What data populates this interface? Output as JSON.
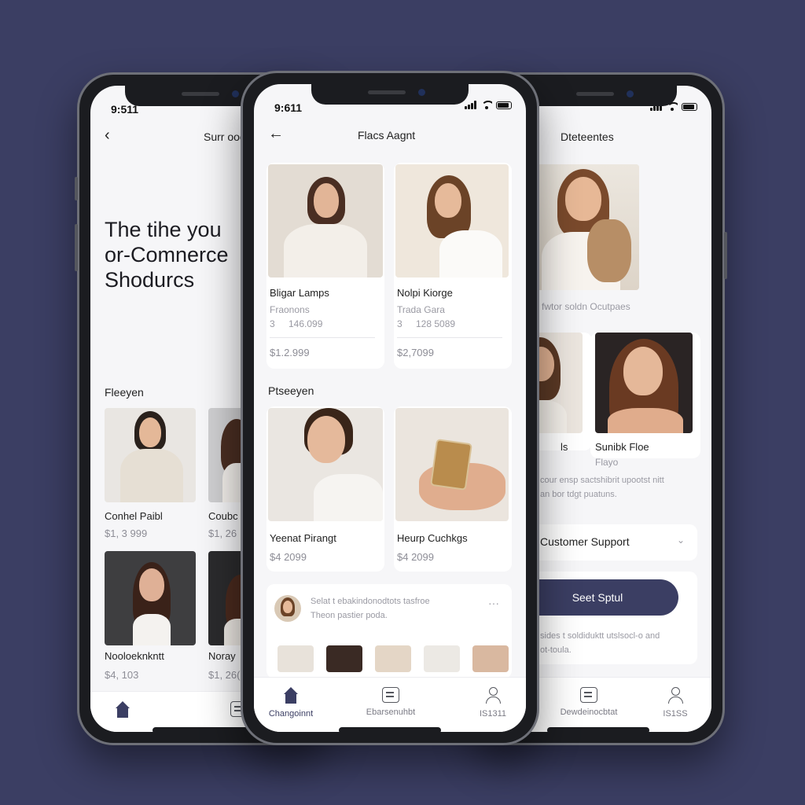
{
  "phone_left": {
    "status_time": "9:511",
    "back_icon": "chevron-left-icon",
    "header_title": "Surr ooo",
    "hero_lines": [
      "The tihe you",
      "or-Comnerce",
      "Shodurcs"
    ],
    "section_label": "Fleeyen",
    "products": [
      {
        "name": "Conhel Paibl",
        "price": "$1, 3 999"
      },
      {
        "name": "Coubc",
        "price": "$1, 26"
      },
      {
        "name": "Nooloeknkntt",
        "price": "$4, 103"
      },
      {
        "name": "Noray",
        "price": "$1, 26("
      }
    ],
    "tabs": [
      {
        "icon": "home-icon"
      },
      {
        "icon": "box-icon"
      }
    ]
  },
  "phone_center": {
    "status_time": "9:611",
    "back_icon": "arrow-left-icon",
    "header_title": "Flacs Aagnt",
    "featured": [
      {
        "name": "Bligar Lamps",
        "sub": "Fraonons",
        "meta_left": "3",
        "meta_right": "146.099",
        "price": "$1.2.999"
      },
      {
        "name": "Nolpi Kiorge",
        "sub": "Trada Gara",
        "meta_left": "3",
        "meta_right": "128 5089",
        "price": "$2,7099"
      }
    ],
    "section_label": "Ptseeyen",
    "products": [
      {
        "name": "Yeenat Pirangt",
        "price": "$4 2099"
      },
      {
        "name": "Heurp Cuchkgs",
        "price": "$4 2099"
      }
    ],
    "review": {
      "line1": "Selat t ebakindonodtots tasfroe",
      "line2": "Theon pastier poda.",
      "more_icon": "more-horizontal-icon"
    },
    "tabs": [
      {
        "icon": "home-icon",
        "label": "Changoinnt"
      },
      {
        "icon": "box-icon",
        "label": "Ebarsenuhbt"
      },
      {
        "icon": "user-icon",
        "label": "IS1311"
      }
    ]
  },
  "phone_right": {
    "header_title": "Dteteentes",
    "top_caption": "fwtor soldn Ocutpaes",
    "product_name": "Sunibk Floe",
    "product_sub": "Flayo",
    "left_tag": "ls",
    "desc_line1": "cour ensp sactshibrit upootst nitt",
    "desc_line2": "an bor tdgt puatuns.",
    "support_label": "Customer Support",
    "support_icon": "chevron-down-icon",
    "cta_label": "Seet Sptul",
    "foot_line1": "sides t soldiduktt utslsocl-o and",
    "foot_line2": "ot-toula.",
    "tabs": [
      {
        "icon": "box-icon",
        "label": "Dewdeinocbtat"
      },
      {
        "icon": "user-icon",
        "label": "IS1SS"
      }
    ]
  },
  "colors": {
    "background": "#3b3e63",
    "accent": "#3b3e63",
    "card": "#ffffff"
  }
}
